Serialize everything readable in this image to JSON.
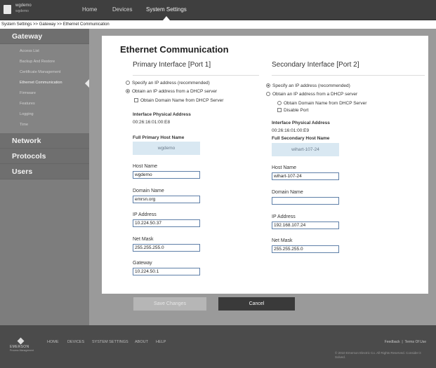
{
  "topbar": {
    "device_name": "wgdemo",
    "device_sub": "wgdemo",
    "nav": [
      "Home",
      "Devices",
      "System Settings"
    ]
  },
  "breadcrumb": "System Settings >> Gateway >> Ethernet Communication",
  "sidebar": {
    "gateway": "Gateway",
    "items": [
      "Access List",
      "Backup And Restore",
      "Certificate Management",
      "Ethernet Communication",
      "Firmware",
      "Features",
      "Logging",
      "Time"
    ],
    "network": "Network",
    "protocols": "Protocols",
    "users": "Users"
  },
  "main": {
    "title": "Ethernet Communication",
    "primary": {
      "heading": "Primary Interface [Port 1]",
      "opt_specify": "Specify an IP address (recommended)",
      "opt_dhcp": "Obtain an IP address from a DHCP server",
      "opt_domain": "Obtain Domain Name from DHCP Server",
      "phys_label": "Interface Physical Address",
      "phys_value": "00:26:16:01:00:E8",
      "host_full_label": "Full Primary Host Name",
      "host_full_value": "wgdemo",
      "host_label": "Host Name",
      "host_value": "wgdemo",
      "domain_label": "Domain Name",
      "domain_value": "emrsn.org",
      "ip_label": "IP Address",
      "ip_value": "10.224.50.37",
      "mask_label": "Net Mask",
      "mask_value": "255.255.255.0",
      "gw_label": "Gateway",
      "gw_value": "10.224.50.1"
    },
    "secondary": {
      "heading": "Secondary Interface [Port 2]",
      "opt_specify": "Specify an IP address (recommended)",
      "opt_dhcp": "Obtain an IP address from a DHCP server",
      "opt_domain": "Obtain Domain Name from DHCP Server",
      "opt_disable": "Disable Port",
      "phys_label": "Interface Physical Address",
      "phys_value": "00:26:16:01:00:E9",
      "host_full_label": "Full Secondary Host Name",
      "host_full_value": "wihart-107-24",
      "host_label": "Host Name",
      "host_value": "wihart-107-24",
      "domain_label": "Domain Name",
      "domain_value": "",
      "ip_label": "IP Address",
      "ip_value": "192.168.107.24",
      "mask_label": "Net Mask",
      "mask_value": "255.255.255.0"
    },
    "save_label": "Save Changes",
    "cancel_label": "Cancel"
  },
  "footer": {
    "logo_text": "EMERSON",
    "logo_sub": "Process Management",
    "links": [
      "HOME",
      "DEVICES",
      "SYSTEM SETTINGS",
      "ABOUT",
      "HELP"
    ],
    "feedback": "Feedback",
    "terms": "Terms Of Use",
    "copyright": "© 2010 Emerson Electric Co. All Rights Reserved. Consider it Solved."
  }
}
